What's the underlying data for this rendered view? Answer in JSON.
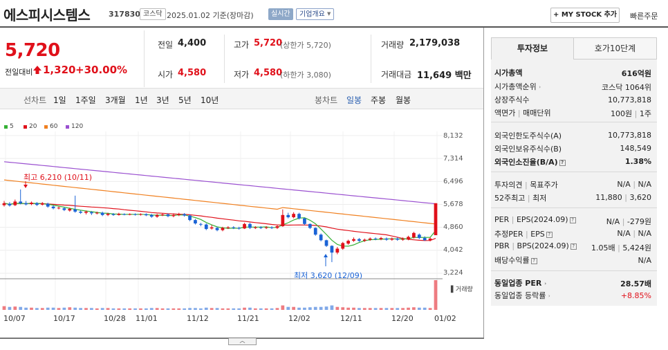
{
  "header": {
    "name": "에스피시스템스",
    "code": "317830",
    "market": "코스닥",
    "date": "2025.01.02",
    "basis": "기준(장마감)",
    "realtime": "실시간",
    "company_info": "기업개요",
    "mystock": "MY STOCK 추가",
    "quick_order": "빠른주문"
  },
  "price": {
    "current": "5,720",
    "change_label": "전일대비",
    "change": "1,320",
    "change_pct": "+30.00%"
  },
  "quote": {
    "prev_label": "전일",
    "prev": "4,400",
    "high_label": "고가",
    "high": "5,720",
    "high_limit": "(상한가 5,720)",
    "vol_label": "거래량",
    "vol": "2,179,038",
    "open_label": "시가",
    "open": "4,580",
    "low_label": "저가",
    "low": "4,580",
    "low_limit": "(하한가 3,080)",
    "amount_label": "거래대금",
    "amount": "11,649 백만"
  },
  "periods": {
    "line_chart": "선차트",
    "items": [
      "1일",
      "1주일",
      "3개월",
      "1년",
      "3년",
      "5년",
      "10년"
    ],
    "candle_chart": "봉차트",
    "candle_items": [
      "일봉",
      "주봉",
      "월봉"
    ]
  },
  "colors": {
    "up": "#e0101a",
    "down": "#1a63d6",
    "ma5": "#35b035",
    "ma20": "#e0101a",
    "ma60": "#f08020",
    "ma120": "#9a50d0"
  },
  "chart_data": {
    "type": "candlestick",
    "legend": [
      "5",
      "20",
      "60",
      "120"
    ],
    "yticks": [
      "8,132",
      "7,314",
      "6,496",
      "5,678",
      "4,860",
      "4,042",
      "3,224"
    ],
    "ylim": [
      3224,
      8132
    ],
    "xticks": [
      "10/07",
      "10/17",
      "10/28",
      "11/01",
      "11/12",
      "11/21",
      "12/02",
      "12/11",
      "12/20",
      "01/02"
    ],
    "high_annotation": "최고 6,210 (10/11)",
    "low_annotation": "최저 3,620 (12/09)",
    "volume_label": "거래량",
    "candles": [
      {
        "o": 5650,
        "c": 5720,
        "h": 5800,
        "l": 5600
      },
      {
        "o": 5700,
        "c": 5640,
        "h": 5760,
        "l": 5600
      },
      {
        "o": 5650,
        "c": 5780,
        "h": 5850,
        "l": 5620
      },
      {
        "o": 5780,
        "c": 5720,
        "h": 6210,
        "l": 5680
      },
      {
        "o": 5720,
        "c": 5680,
        "h": 5800,
        "l": 5640
      },
      {
        "o": 5690,
        "c": 5740,
        "h": 5780,
        "l": 5650
      },
      {
        "o": 5720,
        "c": 5660,
        "h": 5760,
        "l": 5620
      },
      {
        "o": 5670,
        "c": 5720,
        "h": 5760,
        "l": 5640
      },
      {
        "o": 5700,
        "c": 5600,
        "h": 5740,
        "l": 5560
      },
      {
        "o": 5600,
        "c": 5540,
        "h": 5640,
        "l": 5500
      },
      {
        "o": 5540,
        "c": 5560,
        "h": 5600,
        "l": 5500
      },
      {
        "o": 5540,
        "c": 5480,
        "h": 5580,
        "l": 5440
      },
      {
        "o": 5460,
        "c": 5520,
        "h": 5560,
        "l": 5420
      },
      {
        "o": 5500,
        "c": 5420,
        "h": 5990,
        "l": 5380
      },
      {
        "o": 5420,
        "c": 5380,
        "h": 5460,
        "l": 5340
      },
      {
        "o": 5380,
        "c": 5420,
        "h": 5460,
        "l": 5320
      },
      {
        "o": 5400,
        "c": 5360,
        "h": 5440,
        "l": 5300
      },
      {
        "o": 5360,
        "c": 5380,
        "h": 5420,
        "l": 5320
      },
      {
        "o": 5380,
        "c": 5300,
        "h": 5420,
        "l": 5260
      },
      {
        "o": 5300,
        "c": 5340,
        "h": 5380,
        "l": 5260
      },
      {
        "o": 5330,
        "c": 5300,
        "h": 5370,
        "l": 5270
      },
      {
        "o": 5300,
        "c": 5340,
        "h": 5380,
        "l": 5280
      },
      {
        "o": 5330,
        "c": 5320,
        "h": 5360,
        "l": 5290
      },
      {
        "o": 5320,
        "c": 5330,
        "h": 5360,
        "l": 5290
      },
      {
        "o": 5330,
        "c": 5310,
        "h": 5360,
        "l": 5280
      },
      {
        "o": 5310,
        "c": 5330,
        "h": 5360,
        "l": 5280
      },
      {
        "o": 5330,
        "c": 5290,
        "h": 5360,
        "l": 5260
      },
      {
        "o": 5300,
        "c": 5240,
        "h": 5340,
        "l": 5200
      },
      {
        "o": 5240,
        "c": 5300,
        "h": 5340,
        "l": 5200
      },
      {
        "o": 5290,
        "c": 5320,
        "h": 5360,
        "l": 5260
      },
      {
        "o": 5320,
        "c": 5260,
        "h": 5360,
        "l": 5220
      },
      {
        "o": 5260,
        "c": 5300,
        "h": 5360,
        "l": 5220
      },
      {
        "o": 5300,
        "c": 5340,
        "h": 5380,
        "l": 5260
      },
      {
        "o": 5330,
        "c": 5280,
        "h": 5370,
        "l": 5240
      },
      {
        "o": 5280,
        "c": 5120,
        "h": 5320,
        "l": 5080
      },
      {
        "o": 5120,
        "c": 5000,
        "h": 5160,
        "l": 4960
      },
      {
        "o": 4980,
        "c": 4960,
        "h": 5020,
        "l": 4900
      },
      {
        "o": 4960,
        "c": 4800,
        "h": 5000,
        "l": 4760
      },
      {
        "o": 4820,
        "c": 4860,
        "h": 4940,
        "l": 4780
      },
      {
        "o": 4840,
        "c": 4760,
        "h": 4880,
        "l": 4720
      },
      {
        "o": 4760,
        "c": 4840,
        "h": 4880,
        "l": 4720
      },
      {
        "o": 4840,
        "c": 4860,
        "h": 4900,
        "l": 4800
      },
      {
        "o": 4860,
        "c": 4840,
        "h": 4900,
        "l": 4800
      },
      {
        "o": 4840,
        "c": 4820,
        "h": 4880,
        "l": 4780
      },
      {
        "o": 4820,
        "c": 4980,
        "h": 5020,
        "l": 4800
      },
      {
        "o": 4980,
        "c": 4840,
        "h": 5020,
        "l": 4800
      },
      {
        "o": 4840,
        "c": 4860,
        "h": 4900,
        "l": 4800
      },
      {
        "o": 4860,
        "c": 4840,
        "h": 4900,
        "l": 4800
      },
      {
        "o": 4840,
        "c": 4860,
        "h": 4900,
        "l": 4800
      },
      {
        "o": 4860,
        "c": 4840,
        "h": 4900,
        "l": 4800
      },
      {
        "o": 4840,
        "c": 4900,
        "h": 4940,
        "l": 4800
      },
      {
        "o": 4900,
        "c": 5300,
        "h": 5500,
        "l": 4880
      },
      {
        "o": 5300,
        "c": 5220,
        "h": 5380,
        "l": 5180
      },
      {
        "o": 5220,
        "c": 5340,
        "h": 5400,
        "l": 5180
      },
      {
        "o": 5340,
        "c": 5180,
        "h": 5380,
        "l": 5140
      },
      {
        "o": 5180,
        "c": 4980,
        "h": 5200,
        "l": 4940
      },
      {
        "o": 4980,
        "c": 4840,
        "h": 5000,
        "l": 4800
      },
      {
        "o": 4840,
        "c": 4600,
        "h": 4860,
        "l": 4560
      },
      {
        "o": 4600,
        "c": 4400,
        "h": 4640,
        "l": 4360
      },
      {
        "o": 4400,
        "c": 4200,
        "h": 4420,
        "l": 4160
      },
      {
        "o": 4200,
        "c": 3960,
        "h": 4220,
        "l": 3620
      },
      {
        "o": 3960,
        "c": 4100,
        "h": 4160,
        "l": 3900
      },
      {
        "o": 4100,
        "c": 4300,
        "h": 4340,
        "l": 4060
      },
      {
        "o": 4280,
        "c": 4380,
        "h": 4420,
        "l": 4240
      },
      {
        "o": 4380,
        "c": 4440,
        "h": 4500,
        "l": 4340
      },
      {
        "o": 4440,
        "c": 4380,
        "h": 4480,
        "l": 4340
      },
      {
        "o": 4380,
        "c": 4420,
        "h": 4460,
        "l": 4340
      },
      {
        "o": 4420,
        "c": 4460,
        "h": 4500,
        "l": 4380
      },
      {
        "o": 4460,
        "c": 4440,
        "h": 4500,
        "l": 4400
      },
      {
        "o": 4440,
        "c": 4480,
        "h": 4520,
        "l": 4400
      },
      {
        "o": 4460,
        "c": 4420,
        "h": 4500,
        "l": 4380
      },
      {
        "o": 4420,
        "c": 4460,
        "h": 4500,
        "l": 4380
      },
      {
        "o": 4460,
        "c": 4420,
        "h": 4500,
        "l": 4380
      },
      {
        "o": 4420,
        "c": 4440,
        "h": 4500,
        "l": 4380
      },
      {
        "o": 4440,
        "c": 4520,
        "h": 4560,
        "l": 4400
      },
      {
        "o": 4500,
        "c": 4660,
        "h": 4700,
        "l": 4460
      },
      {
        "o": 4600,
        "c": 4480,
        "h": 4640,
        "l": 4440
      },
      {
        "o": 4480,
        "c": 4400,
        "h": 4540,
        "l": 4380
      },
      {
        "o": 4400,
        "c": 4460,
        "h": 4500,
        "l": 4360
      },
      {
        "o": 4580,
        "c": 5720,
        "h": 5720,
        "l": 4580
      }
    ],
    "volumes": [
      50,
      40,
      45,
      40,
      30,
      30,
      25,
      25,
      30,
      30,
      25,
      30,
      35,
      30,
      25,
      25,
      25,
      20,
      25,
      25,
      20,
      20,
      20,
      20,
      20,
      20,
      20,
      25,
      25,
      20,
      20,
      20,
      20,
      20,
      25,
      25,
      20,
      30,
      25,
      25,
      20,
      20,
      20,
      20,
      30,
      30,
      20,
      20,
      20,
      20,
      25,
      60,
      40,
      40,
      30,
      30,
      35,
      40,
      40,
      45,
      60,
      40,
      35,
      30,
      30,
      25,
      25,
      25,
      25,
      25,
      25,
      25,
      25,
      25,
      30,
      35,
      30,
      30,
      25,
      400
    ]
  },
  "tabs": {
    "invest": "투자정보",
    "hoga": "호가10단계"
  },
  "invest": {
    "mcap_label": "시가총액",
    "mcap": "616억원",
    "rank_label": "시가총액순위",
    "rank": "코스닥 1064위",
    "shares_label": "상장주식수",
    "shares": "10,773,818",
    "par_label": "액면가",
    "par_sep": "매매단위",
    "par": "100원",
    "par_unit": "1주",
    "frn_limit_label": "외국인한도주식수(A)",
    "frn_limit": "10,773,818",
    "frn_hold_label": "외국인보유주식수(B)",
    "frn_hold": "148,549",
    "frn_ratio_label": "외국인소진율(B/A)",
    "frn_ratio": "1.38%",
    "opinion_label": "투자의견",
    "target_label": "목표주가",
    "opinion": "N/A",
    "target": "N/A",
    "w52_label": "52주최고",
    "w52_low_label": "최저",
    "w52_high": "11,880",
    "w52_low": "3,620",
    "per_label": "PER",
    "eps_label": "EPS(2024.09)",
    "per": "N/A",
    "eps": "-279원",
    "est_per_label": "추정PER",
    "est_eps_label": "EPS",
    "est_per": "N/A",
    "est_eps": "N/A",
    "pbr_label": "PBR",
    "bps_label": "BPS(2024.09)",
    "pbr": "1.05배",
    "bps": "5,424원",
    "div_label": "배당수익률",
    "div": "N/A",
    "ind_per_label": "동일업종 PER",
    "ind_per": "28.57배",
    "ind_chg_label": "동일업종 등락률",
    "ind_chg": "+8.85%"
  }
}
